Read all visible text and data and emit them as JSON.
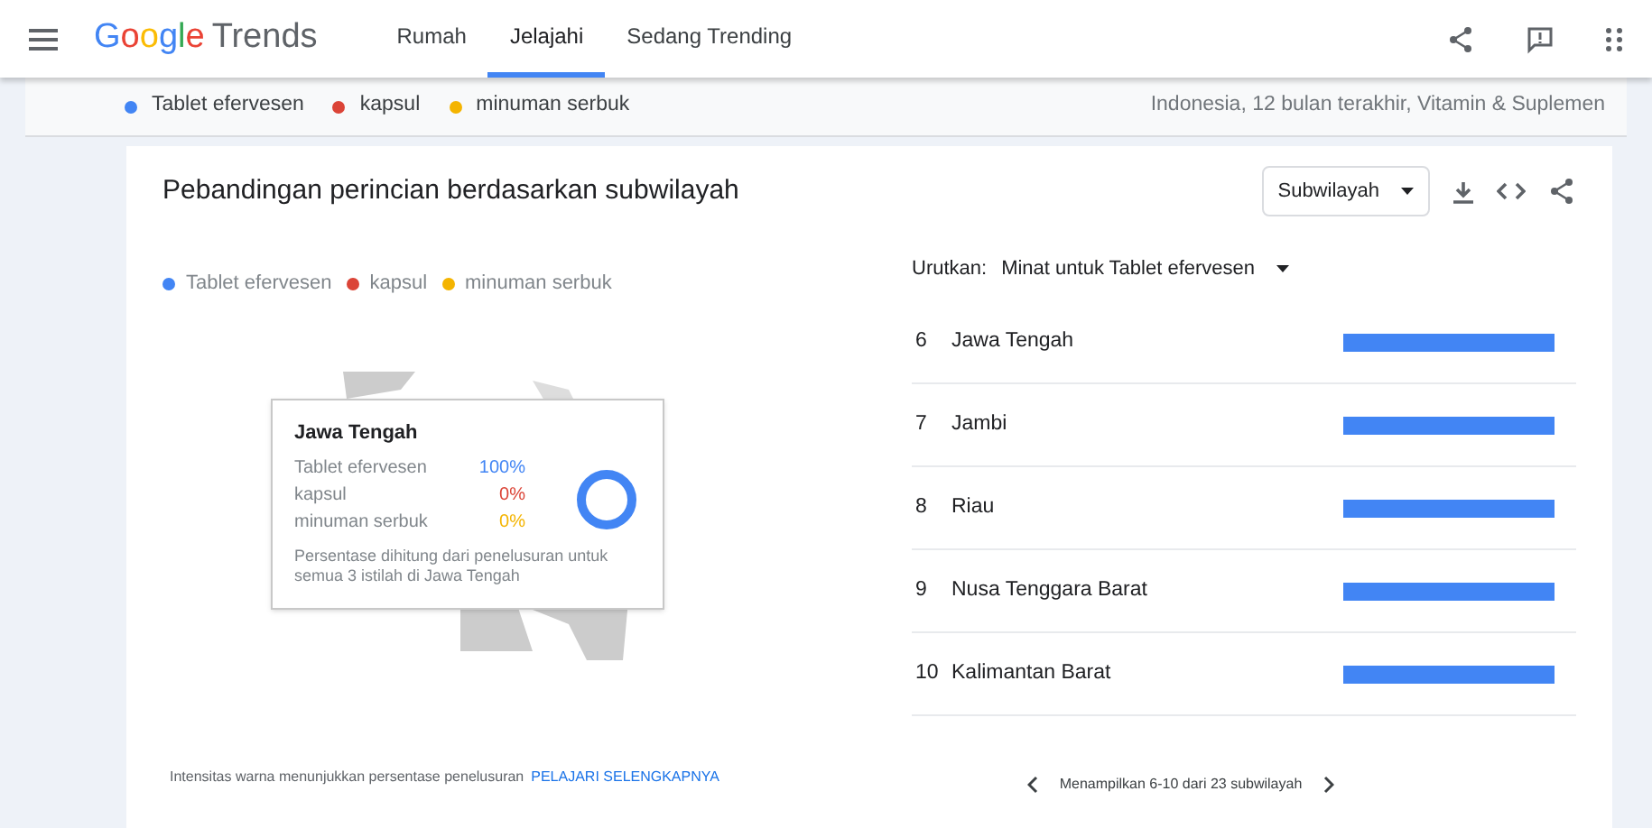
{
  "header": {
    "logo_word": "Google",
    "logo_product": "Trends",
    "tabs": [
      {
        "label": "Rumah",
        "selected": false
      },
      {
        "label": "Jelajahi",
        "selected": true
      },
      {
        "label": "Sedang Trending",
        "selected": false
      }
    ]
  },
  "filter_bar": {
    "terms": [
      {
        "label": "Tablet efervesen",
        "color": "#4285f4"
      },
      {
        "label": "kapsul",
        "color": "#db4437"
      },
      {
        "label": "minuman serbuk",
        "color": "#f4b400"
      }
    ],
    "summary": "Indonesia, 12 bulan terakhir, Vitamin & Suplemen"
  },
  "card": {
    "title": "Pebandingan perincian berdasarkan subwilayah",
    "dropdown": "Subwilayah",
    "legend": [
      {
        "label": "Tablet efervesen",
        "color": "#4285f4"
      },
      {
        "label": "kapsul",
        "color": "#db4437"
      },
      {
        "label": "minuman serbuk",
        "color": "#f4b400"
      }
    ],
    "tooltip": {
      "title": "Jawa Tengah",
      "rows": [
        {
          "label": "Tablet efervesen",
          "value": "100%",
          "color": "#4285f4"
        },
        {
          "label": "kapsul",
          "value": "0%",
          "color": "#db4437"
        },
        {
          "label": "minuman serbuk",
          "value": "0%",
          "color": "#f4b400"
        }
      ],
      "note": "Persentase dihitung dari penelusuran untuk semua 3 istilah di Jawa Tengah"
    },
    "sort_label": "Urutkan:",
    "sort_value": "Minat untuk Tablet efervesen",
    "rows": [
      {
        "rank": "6",
        "name": "Jawa Tengah",
        "level": 1
      },
      {
        "rank": "7",
        "name": "Jambi",
        "level": 1
      },
      {
        "rank": "8",
        "name": "Riau",
        "level": 1
      },
      {
        "rank": "9",
        "name": "Nusa Tenggara Barat",
        "level": 1
      },
      {
        "rank": "10",
        "name": "Kalimantan Barat",
        "level": 1
      }
    ],
    "footer_note": "Intensitas warna menunjukkan persentase penelusuran",
    "footer_link": "PELAJARI SELENGKAPNYA",
    "pagination": "Menampilkan 6-10 dari 23 subwilayah"
  }
}
